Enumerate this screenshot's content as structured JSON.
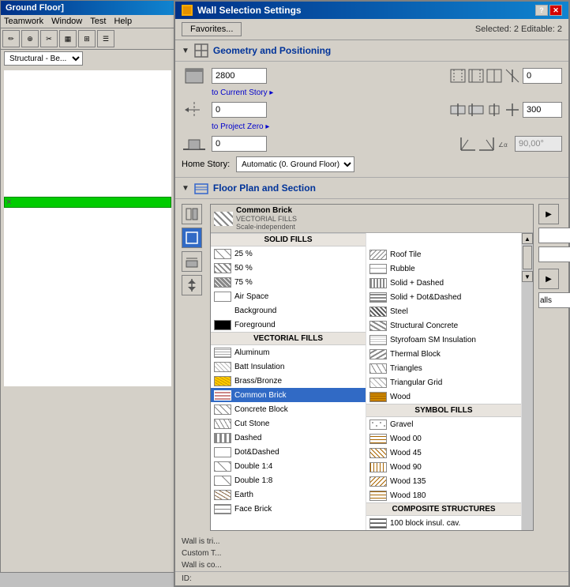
{
  "bgWindow": {
    "title": "Ground Floor]",
    "menuItems": [
      "Teamwork",
      "Window",
      "Test",
      "Help"
    ]
  },
  "dialog": {
    "title": "Wall Selection Settings",
    "selectedInfo": "Selected: 2 Editable: 2",
    "favoritesLabel": "Favorites...",
    "sections": {
      "geometry": {
        "title": "Geometry and Positioning",
        "inputs": {
          "height": "2800",
          "toCurrentStory": "0",
          "toProjectZero": "0",
          "rightValue": "0",
          "rightValue2": "300",
          "rightValue3": "90,00°"
        },
        "links": {
          "toCurrentStory": "to Current Story ▸",
          "toProjectZero": "to Project Zero ▸"
        },
        "homeStory": {
          "label": "Home Story:",
          "value": "Automatic (0. Ground Floor)"
        }
      },
      "floorPlan": {
        "title": "Floor Plan and Section",
        "fillHeader": {
          "name": "Common Brick",
          "category": "VECTORIAL FILLS",
          "subtext": "Scale-independent"
        },
        "leftColumn": {
          "category": "SOLID FILLS",
          "items": [
            {
              "label": "25 %",
              "pattern": "fp-25"
            },
            {
              "label": "50 %",
              "pattern": "fp-50"
            },
            {
              "label": "75 %",
              "pattern": "fp-75"
            },
            {
              "label": "Air Space",
              "pattern": "fp-air"
            },
            {
              "label": "Background",
              "pattern": "fp-bg"
            },
            {
              "label": "Foreground",
              "pattern": "fp-fg"
            }
          ],
          "category2": "VECTORIAL FILLS",
          "items2": [
            {
              "label": "Aluminum",
              "pattern": "fp-alum"
            },
            {
              "label": "Batt Insulation",
              "pattern": "fp-batt"
            },
            {
              "label": "Brass/Bronze",
              "pattern": "fp-brass"
            },
            {
              "label": "Common Brick",
              "pattern": "fp-common",
              "selected": true
            },
            {
              "label": "Concrete Block",
              "pattern": "fp-concrete"
            },
            {
              "label": "Cut Stone",
              "pattern": "fp-cut"
            },
            {
              "label": "Dashed",
              "pattern": "fp-dashed"
            },
            {
              "label": "Dot&Dashed",
              "pattern": "fp-dotdash"
            },
            {
              "label": "Double 1:4",
              "pattern": "fp-double14"
            },
            {
              "label": "Double 1:8",
              "pattern": "fp-double18"
            },
            {
              "label": "Earth",
              "pattern": "fp-earth"
            },
            {
              "label": "Face Brick",
              "pattern": "fp-face"
            }
          ]
        },
        "rightColumn": {
          "items": [
            {
              "label": "Roof Tile",
              "pattern": "fp-roof"
            },
            {
              "label": "Rubble",
              "pattern": "fp-rubble"
            },
            {
              "label": "Solid + Dashed",
              "pattern": "fp-solid-dashed"
            },
            {
              "label": "Solid + Dot&Dashed",
              "pattern": "fp-solid-dotdash"
            },
            {
              "label": "Steel",
              "pattern": "fp-steel"
            },
            {
              "label": "Structural Concrete",
              "pattern": "fp-struct-concrete"
            },
            {
              "label": "Styrofoam SM Insulation",
              "pattern": "fp-styro"
            },
            {
              "label": "Thermal Block",
              "pattern": "fp-thermal"
            },
            {
              "label": "Triangles",
              "pattern": "fp-triangles"
            },
            {
              "label": "Triangular Grid",
              "pattern": "fp-trig"
            },
            {
              "label": "Wood",
              "pattern": "fp-wood"
            }
          ],
          "category2": "SYMBOL FILLS",
          "items2": [
            {
              "label": "Gravel",
              "pattern": "fp-gravel"
            },
            {
              "label": "Wood  00",
              "pattern": "fp-wood00"
            },
            {
              "label": "Wood  45",
              "pattern": "fp-wood45"
            },
            {
              "label": "Wood  90",
              "pattern": "fp-wood90"
            },
            {
              "label": "Wood 135",
              "pattern": "fp-wood135"
            },
            {
              "label": "Wood 180",
              "pattern": "fp-wood180"
            }
          ],
          "category3": "COMPOSITE STRUCTURES",
          "items3": [
            {
              "label": "100 block insul. cav.",
              "pattern": "fp-composite"
            }
          ]
        }
      }
    },
    "wallInfo": [
      "Wall is tri...",
      "Custom T...",
      "Wall is co..."
    ],
    "idLabel": "ID:"
  }
}
